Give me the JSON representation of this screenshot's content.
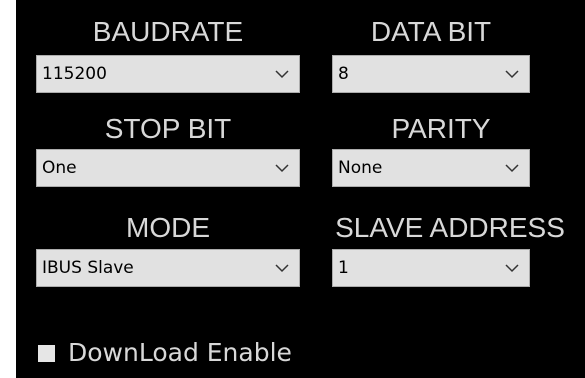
{
  "labels": {
    "baudrate": "BAUDRATE",
    "data_bit": "DATA BIT",
    "stop_bit": "STOP BIT",
    "parity": "PARITY",
    "mode": "MODE",
    "slave_address": "SLAVE ADDRESS"
  },
  "fields": {
    "baudrate": "115200",
    "data_bit": "8",
    "stop_bit": "One",
    "parity": "None",
    "mode": "IBUS Slave",
    "slave_address": "1"
  },
  "download_enable": {
    "label": "DownLoad Enable",
    "checked": false
  },
  "colors": {
    "panel_background": "#000000",
    "label_text": "#d8d8d8",
    "combo_background": "#e1e1e1",
    "combo_border": "#adadad"
  },
  "icons": {
    "dropdown": "chevron-down-icon",
    "checkbox": "checkbox-unchecked"
  }
}
